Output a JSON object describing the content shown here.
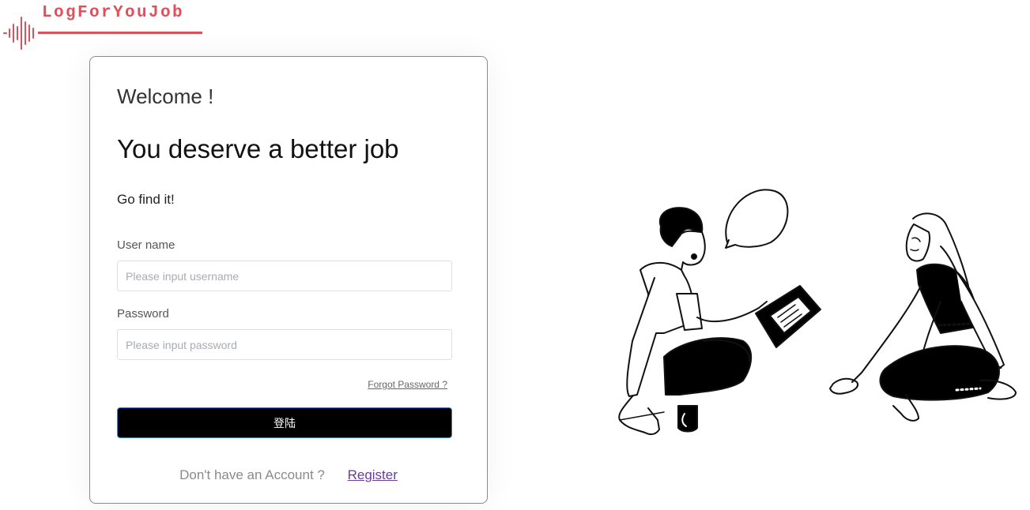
{
  "logo": {
    "text": "LogForYouJob",
    "color": "#e0505a"
  },
  "card": {
    "welcome": "Welcome !",
    "headline": "You deserve a better job",
    "subtitle": "Go find it!",
    "username": {
      "label": "User name",
      "placeholder": "Please input username",
      "value": ""
    },
    "password": {
      "label": "Password",
      "placeholder": "Please input password",
      "value": ""
    },
    "forgot_link": "Forgot Password ?",
    "login_button": "登陆",
    "no_account": "Don't have an Account ?",
    "register_link": "Register"
  },
  "colors": {
    "button_bg": "#000000",
    "button_border": "#3a7bd5",
    "link_visited": "#6a3d9a"
  },
  "illustration": {
    "icon": "two-people-talking-illustration"
  }
}
